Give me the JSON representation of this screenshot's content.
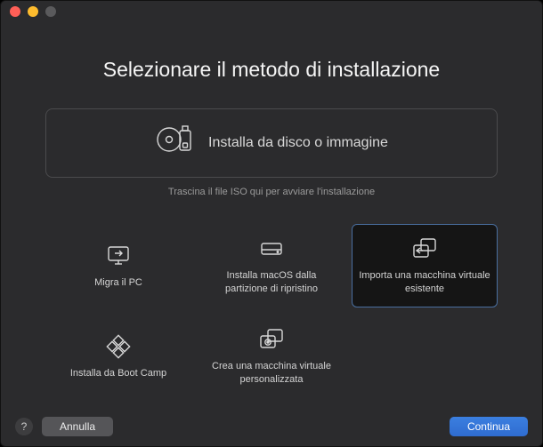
{
  "title": "Selezionare il metodo di installazione",
  "drop_zone": {
    "label": "Installa da disco o immagine",
    "hint": "Trascina il file ISO qui per avviare l'installazione"
  },
  "options": [
    {
      "label": "Migra il PC"
    },
    {
      "label": "Installa macOS dalla partizione di ripristino"
    },
    {
      "label": "Importa una macchina virtuale esistente"
    },
    {
      "label": "Installa da Boot Camp"
    },
    {
      "label": "Crea una macchina virtuale personalizzata"
    }
  ],
  "footer": {
    "help": "?",
    "cancel": "Annulla",
    "continue": "Continua"
  }
}
